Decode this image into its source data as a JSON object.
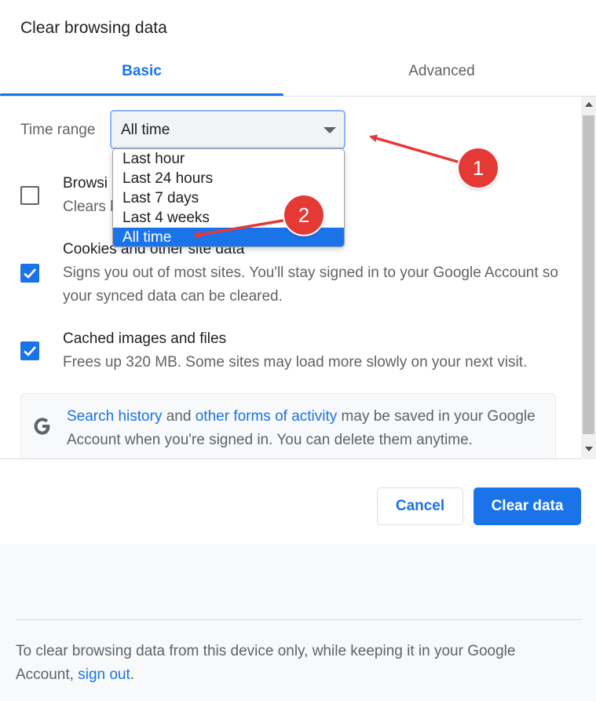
{
  "dialog": {
    "title": "Clear browsing data",
    "tabs": [
      {
        "label": "Basic",
        "active": true
      },
      {
        "label": "Advanced",
        "active": false
      }
    ]
  },
  "time_range": {
    "label": "Time range",
    "value": "All time",
    "options": [
      "Last hour",
      "Last 24 hours",
      "Last 7 days",
      "Last 4 weeks",
      "All time"
    ],
    "selected_index": 4
  },
  "items": [
    {
      "title": "Browsing history",
      "visible_title": "Browsi",
      "desc": "Clears h",
      "checked": false
    },
    {
      "title": "Cookies and other site data",
      "desc": "Signs you out of most sites. You'll stay signed in to your Google Account so your synced data can be cleared.",
      "checked": true
    },
    {
      "title": "Cached images and files",
      "desc": "Frees up 320 MB. Some sites may load more slowly on your next visit.",
      "checked": true
    }
  ],
  "google_notice": {
    "link1": "Search history",
    "and": " and ",
    "link2": "other forms of activity",
    "rest": " may be saved in your Google Account when you're signed in. You can delete them anytime."
  },
  "buttons": {
    "cancel": "Cancel",
    "clear": "Clear data"
  },
  "footer": {
    "text": "To clear browsing data from this device only, while keeping it in your Google Account, ",
    "link": "sign out",
    "end": "."
  },
  "annotations": [
    {
      "label": "1"
    },
    {
      "label": "2"
    }
  ],
  "colors": {
    "accent": "#1a73e8",
    "annotation": "#e53935"
  }
}
